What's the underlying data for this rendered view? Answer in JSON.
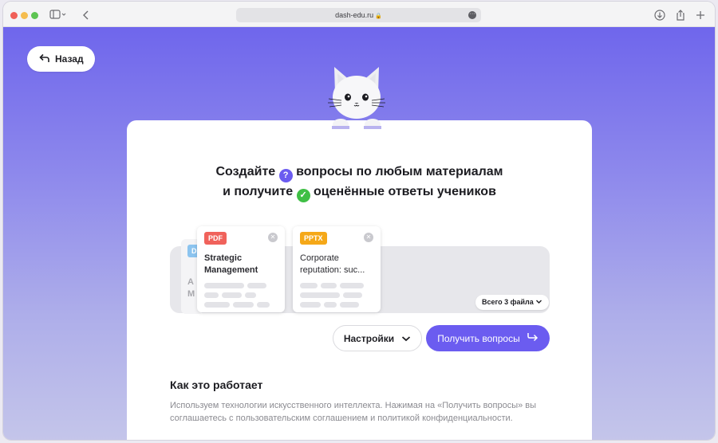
{
  "browser": {
    "url": "dash-edu.ru"
  },
  "page": {
    "back_label": "Назад",
    "headline": {
      "line1_part1": "Создайте",
      "line1_part2": "вопросы по любым материалам",
      "line2_part1": "и получите",
      "line2_part2": "оценённые ответы учеников"
    },
    "files": [
      {
        "tag": "PDF",
        "title": "Strategic Management"
      },
      {
        "tag": "PPTX",
        "title": "Corporate reputation: suc..."
      }
    ],
    "hidden_file": {
      "tag": "D",
      "title": "A M"
    },
    "total_files_label": "Всего 3 файла",
    "settings_label": "Настройки",
    "get_questions_label": "Получить вопросы",
    "how_it_works": {
      "title": "Как это работает",
      "text": "Используем технологии искусственного интеллекта. Нажимая на «Получить вопросы» вы соглашаетесь с пользовательским соглашением и политикой конфиденциальности."
    }
  },
  "colors": {
    "accent": "#6b5cf0",
    "pdf_tag": "#f0625b",
    "pptx_tag": "#f5a818",
    "check_green": "#3fbf45"
  },
  "icons": {
    "back": "arrow-turn-left-icon",
    "question": "question-mark-icon",
    "check": "check-circle-icon",
    "chevron": "chevron-down-icon",
    "arrow": "arrow-right-icon"
  }
}
